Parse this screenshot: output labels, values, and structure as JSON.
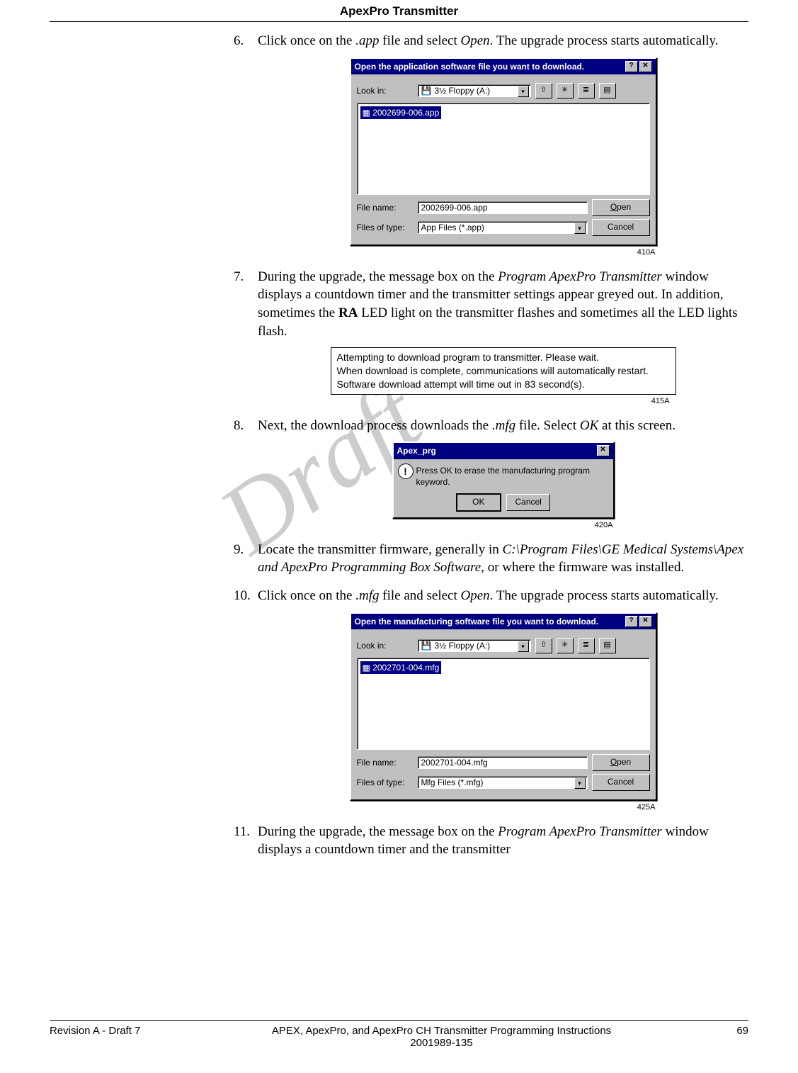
{
  "header": {
    "title": "ApexPro Transmitter"
  },
  "watermark": "Draft",
  "steps": {
    "s6": {
      "num": "6.",
      "pre": "Click once on the ",
      "file": ".app",
      "mid": " file and select ",
      "open": "Open",
      "post": ". The upgrade process starts automatically."
    },
    "s7": {
      "num": "7.",
      "pre": "During the upgrade, the message box on the ",
      "win": "Program ApexPro Transmitter",
      "mid1": " window displays a countdown timer and the transmitter settings appear greyed out. In addition, sometimes the ",
      "ra": "RA",
      "mid2": " LED light on the transmitter flashes and sometimes all the LED lights flash."
    },
    "s8": {
      "num": "8.",
      "pre": "Next, the download process downloads the ",
      "file": ".mfg",
      "mid": " file. Select ",
      "ok": "OK",
      "post": " at this screen."
    },
    "s9": {
      "num": "9.",
      "pre": "Locate the transmitter firmware, generally in ",
      "path": "C:\\Program Files\\GE Medical Systems\\Apex and ApexPro Programming Box Software",
      "post": ", or where the firmware was installed."
    },
    "s10": {
      "num": "10.",
      "pre": "Click once on the ",
      "file": ".mfg",
      "mid": " file and select ",
      "open": "Open",
      "post": ". The upgrade process starts automatically."
    },
    "s11": {
      "num": "11.",
      "pre": "During the upgrade, the message box on the ",
      "win": "Program ApexPro Transmitter",
      "post": " window displays a countdown timer and the transmitter"
    }
  },
  "dlg_app": {
    "title": "Open the application software file you want to download.",
    "lookin_label": "Look in:",
    "lookin_value": "3½ Floppy (A:)",
    "file_item": "2002699-006.app",
    "filename_label": "File name:",
    "filename_value": "2002699-006.app",
    "filetype_label": "Files of type:",
    "filetype_value": "App Files (*.app)",
    "open_btn": "Open",
    "cancel_btn": "Cancel",
    "caption": "410A"
  },
  "status_box": {
    "line1": "Attempting to download program to transmitter. Please wait.",
    "line2": "When download is complete, communications will automatically restart.",
    "line3": "Software download attempt will time out in 83 second(s).",
    "caption": "415A"
  },
  "msgbox": {
    "title": "Apex_prg",
    "text": "Press OK to erase the manufacturing program keyword.",
    "ok": "OK",
    "cancel": "Cancel",
    "caption": "420A"
  },
  "dlg_mfg": {
    "title": "Open the manufacturing software file you want to download.",
    "lookin_label": "Look in:",
    "lookin_value": "3½ Floppy (A:)",
    "file_item": "2002701-004.mfg",
    "filename_label": "File name:",
    "filename_value": "2002701-004.mfg",
    "filetype_label": "Files of type:",
    "filetype_value": "Mfg Files (*.mfg)",
    "open_btn": "Open",
    "cancel_btn": "Cancel",
    "caption": "425A"
  },
  "footer": {
    "left": "Revision A - Draft 7",
    "center1": "APEX, ApexPro, and ApexPro CH Transmitter Programming Instructions",
    "center2": "2001989-135",
    "right": "69"
  }
}
